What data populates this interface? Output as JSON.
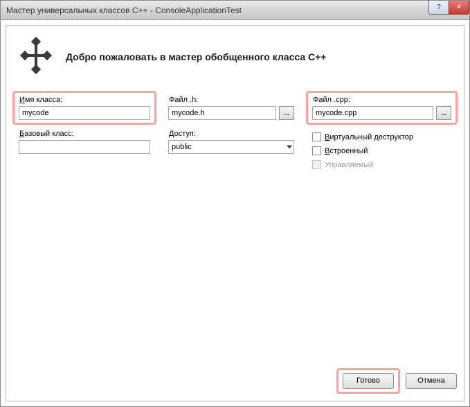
{
  "window": {
    "title": "Мастер универсальных классов C++ - ConsoleApplicationTest",
    "help_glyph": "?",
    "close_glyph": "✕"
  },
  "header": {
    "title": "Добро пожаловать в мастер обобщенного класса C++"
  },
  "fields": {
    "class_name": {
      "label": "Имя класса:",
      "label_u": "И",
      "value": "mycode"
    },
    "file_h": {
      "label": "Файл .h:",
      "value": "mycode.h",
      "browse": "..."
    },
    "file_cpp": {
      "label": "Файл .cpp:",
      "value": "mycode.cpp",
      "browse": "..."
    },
    "base_class": {
      "label": "азовый класс:",
      "label_u": "Б",
      "value": ""
    },
    "access": {
      "label": "оступ:",
      "label_u": "Д",
      "value": "public"
    }
  },
  "checkboxes": {
    "virtual_destructor": {
      "label": "иртуальный деструктор",
      "label_u": "В",
      "checked": false,
      "enabled": true
    },
    "inline": {
      "label": "строенный",
      "label_u": "В",
      "checked": false,
      "enabled": true
    },
    "managed": {
      "label": "Управляемый",
      "checked": false,
      "enabled": false
    }
  },
  "buttons": {
    "finish": "Готово",
    "cancel": "Отмена"
  }
}
